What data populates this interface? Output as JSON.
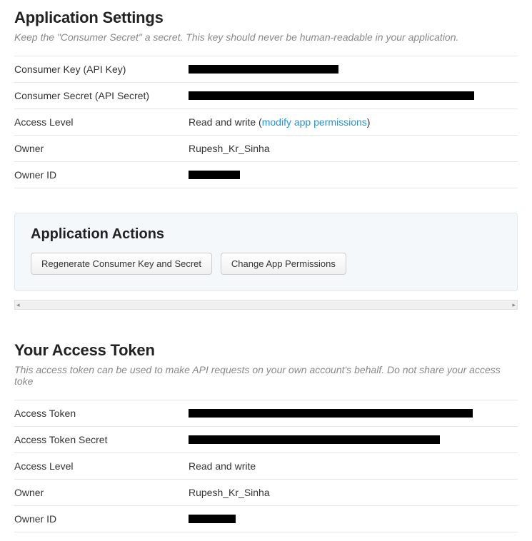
{
  "app_settings": {
    "title": "Application Settings",
    "subtitle": "Keep the \"Consumer Secret\" a secret. This key should never be human-readable in your application.",
    "rows": {
      "consumer_key_label": "Consumer Key (API Key)",
      "consumer_secret_label": "Consumer Secret (API Secret)",
      "access_level_label": "Access Level",
      "access_level_value": "Read and write (",
      "access_level_link": "modify app permissions",
      "access_level_suffix": ")",
      "owner_label": "Owner",
      "owner_value": "Rupesh_Kr_Sinha",
      "owner_id_label": "Owner ID"
    }
  },
  "actions": {
    "title": "Application Actions",
    "regenerate": "Regenerate Consumer Key and Secret",
    "change_perms": "Change App Permissions"
  },
  "access_token": {
    "title": "Your Access Token",
    "subtitle": "This access token can be used to make API requests on your own account's behalf. Do not share your access toke",
    "rows": {
      "token_label": "Access Token",
      "token_secret_label": "Access Token Secret",
      "access_level_label": "Access Level",
      "access_level_value": "Read and write",
      "owner_label": "Owner",
      "owner_value": "Rupesh_Kr_Sinha",
      "owner_id_label": "Owner ID"
    }
  },
  "scroll": {
    "left": "◂",
    "right": "▸"
  }
}
